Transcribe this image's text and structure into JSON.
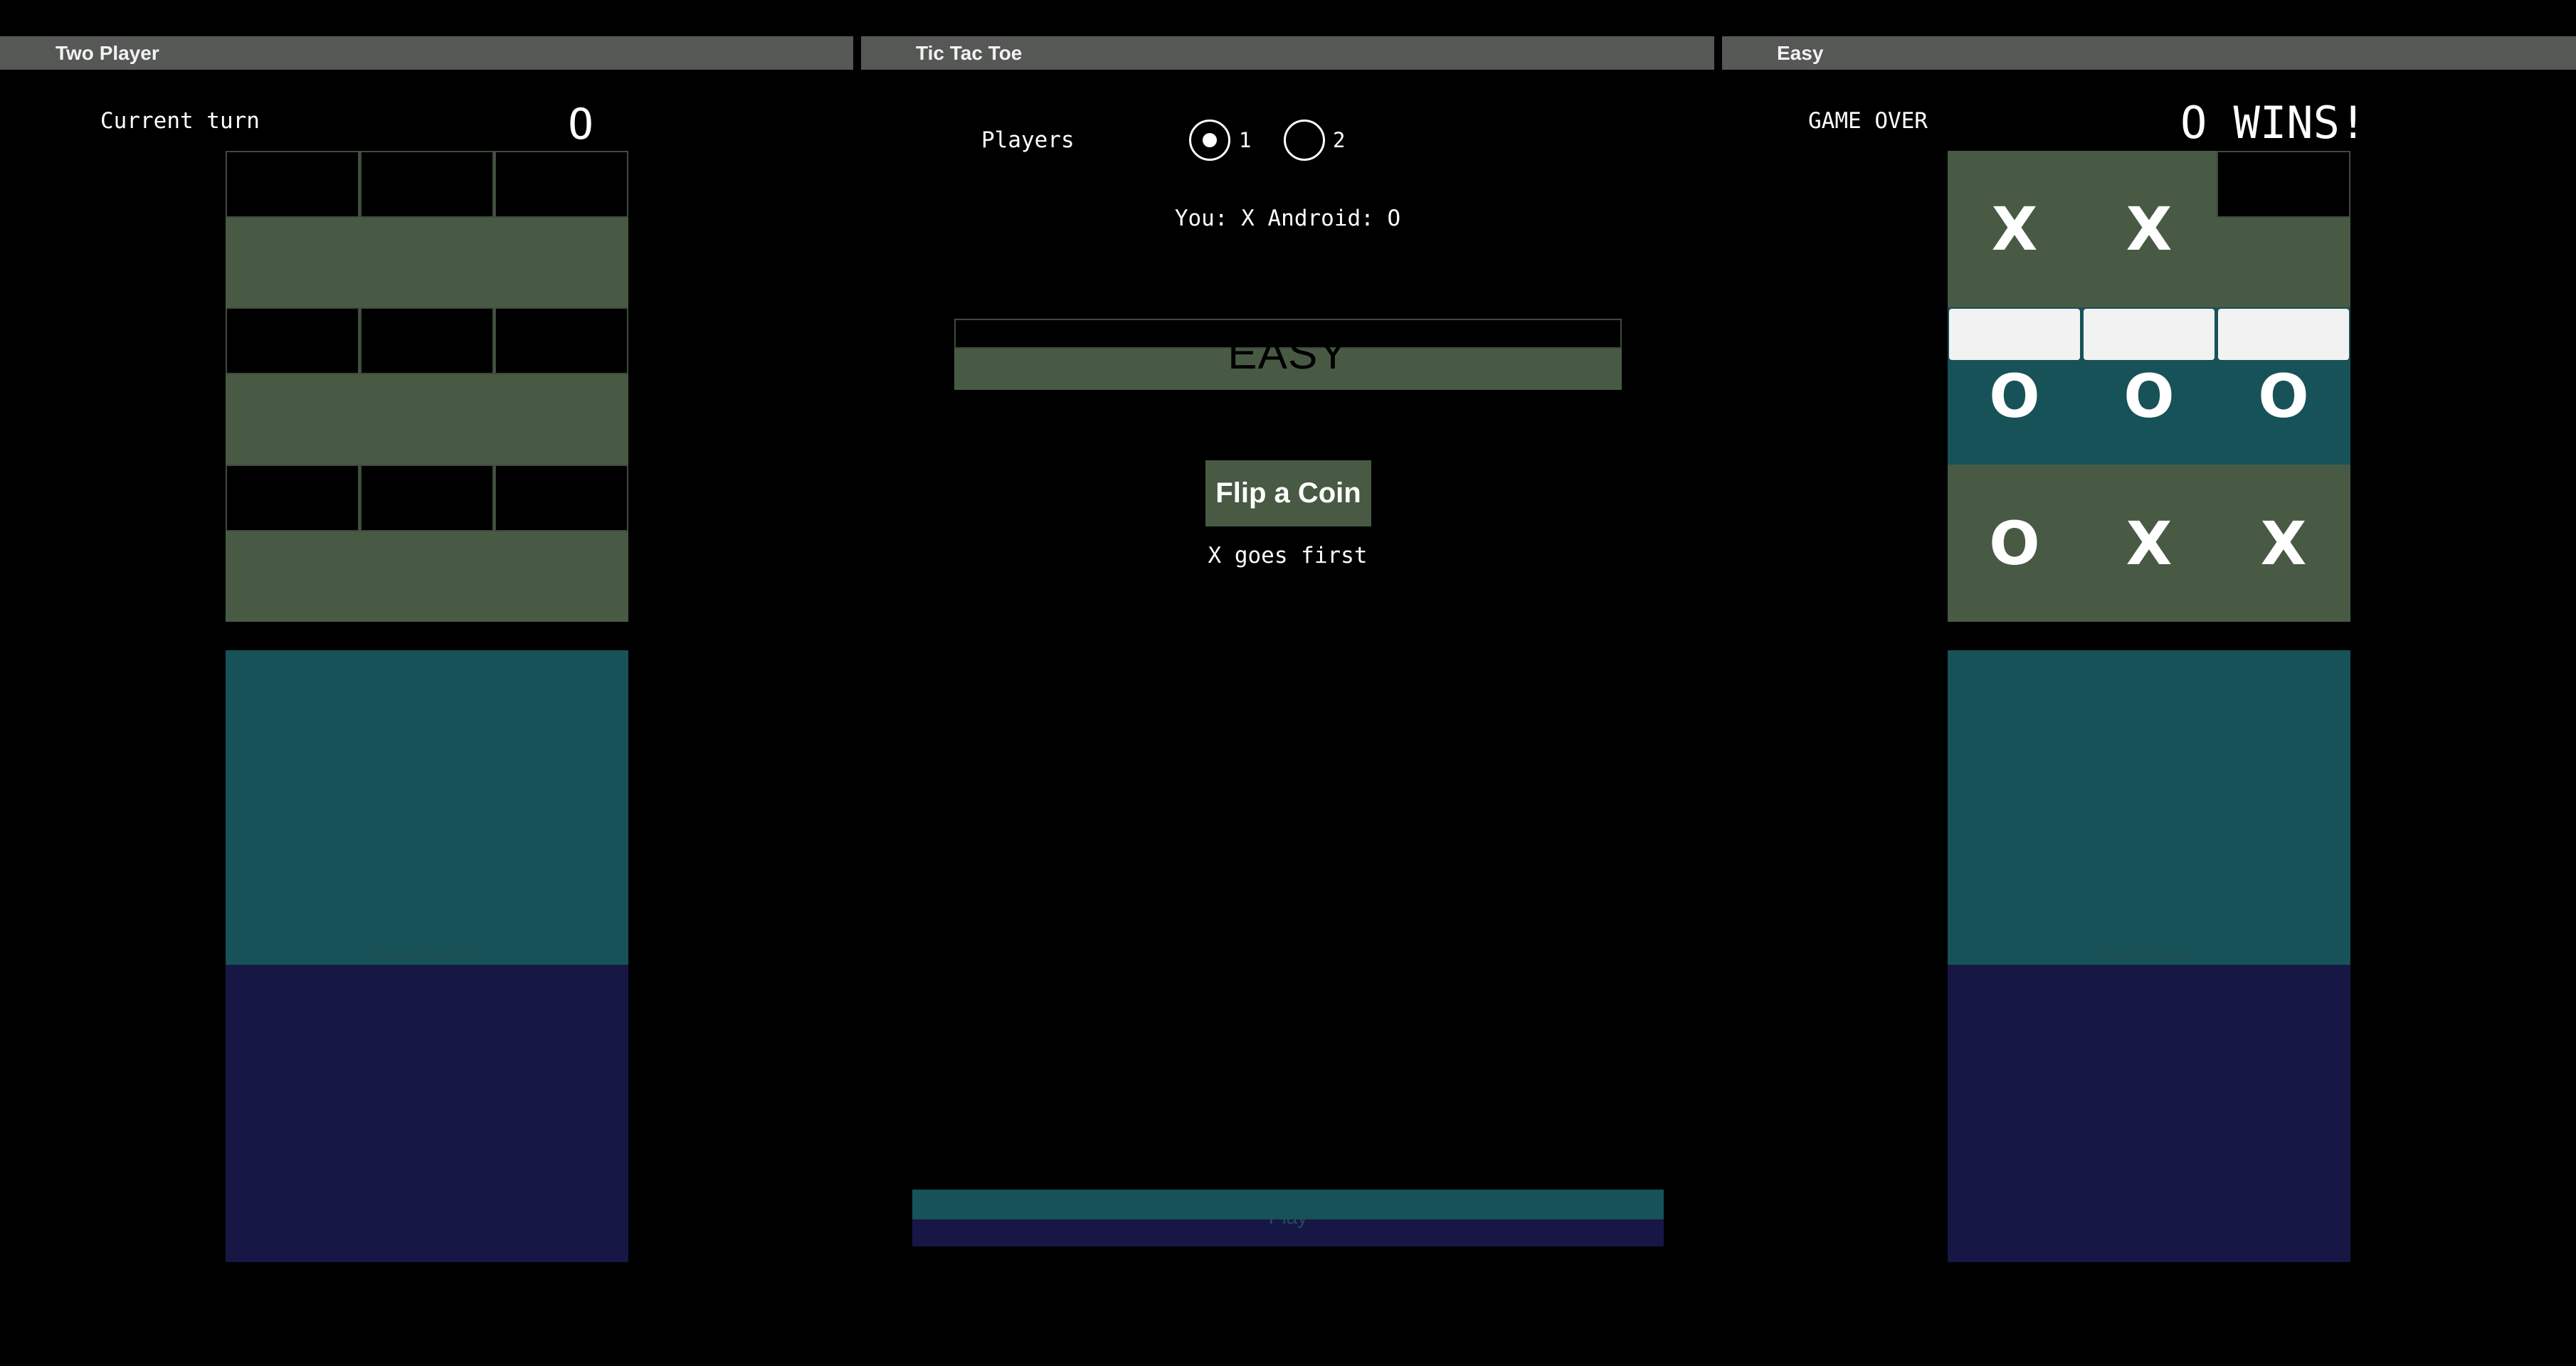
{
  "panels": {
    "left": {
      "title": "Two Player"
    },
    "center": {
      "title": "Tic Tac Toe"
    },
    "right": {
      "title": "Easy"
    }
  },
  "left_game": {
    "status_label": "Current turn",
    "status_value": "O",
    "board": [
      "",
      "",
      "",
      "",
      "",
      "",
      "",
      "",
      ""
    ],
    "new_game_label": "New Game"
  },
  "center_setup": {
    "players_label": "Players",
    "player_options": [
      {
        "label": "1",
        "selected": true
      },
      {
        "label": "2",
        "selected": false
      }
    ],
    "assignment_text": "You: X Android: O",
    "difficulty": "EASY",
    "flip_coin_label": "Flip a Coin",
    "coin_result": "X goes first",
    "play_label": "Play"
  },
  "right_game": {
    "status_label": "GAME OVER",
    "status_value": "O WINS!",
    "board": [
      "X",
      "X",
      "",
      "O",
      "O",
      "O",
      "O",
      "X",
      "X"
    ],
    "winning_row": 1,
    "new_game_label": "New Game"
  },
  "colors": {
    "title_bar": "#555855",
    "board_green": "#485a44",
    "teal": "#175258",
    "navy": "#161745",
    "highlight": "#f2f2f2"
  }
}
